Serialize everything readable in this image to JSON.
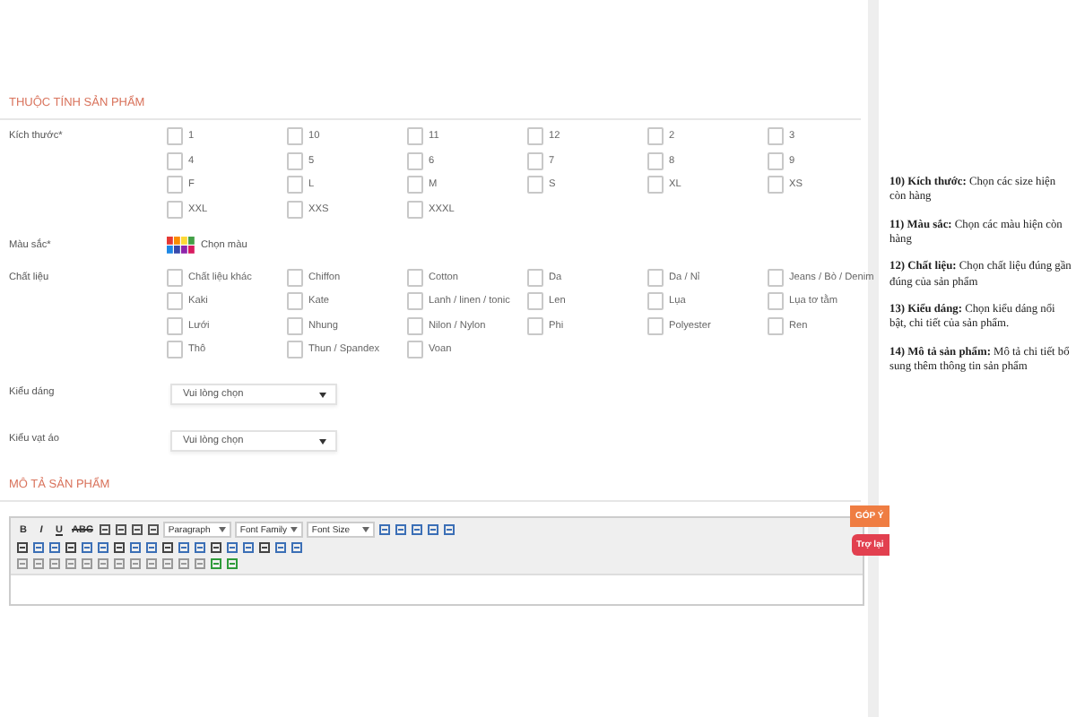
{
  "attributes_section": {
    "title": "THUỘC TÍNH SẢN PHẨM",
    "sizes": {
      "label": "Kích thước*",
      "options": [
        {
          "label": "1",
          "checked": false
        },
        {
          "label": "10",
          "checked": false
        },
        {
          "label": "11",
          "checked": false
        },
        {
          "label": "12",
          "checked": false
        },
        {
          "label": "2",
          "checked": false
        },
        {
          "label": "3",
          "checked": false
        },
        {
          "label": "4",
          "checked": false
        },
        {
          "label": "5",
          "checked": false
        },
        {
          "label": "6",
          "checked": false
        },
        {
          "label": "7",
          "checked": false
        },
        {
          "label": "8",
          "checked": false
        },
        {
          "label": "9",
          "checked": false
        },
        {
          "label": "F",
          "checked": false
        },
        {
          "label": "L",
          "checked": false
        },
        {
          "label": "M",
          "checked": false
        },
        {
          "label": "S",
          "checked": false
        },
        {
          "label": "XL",
          "checked": false
        },
        {
          "label": "XS",
          "checked": false
        },
        {
          "label": "XXL",
          "checked": false
        },
        {
          "label": "XXS",
          "checked": false
        },
        {
          "label": "XXXL",
          "checked": false
        }
      ]
    },
    "color": {
      "label": "Màu sắc*",
      "button": "Chọn màu"
    },
    "materials": {
      "label": "Chất liệu",
      "options": [
        {
          "label": "Chất liệu khác",
          "checked": false
        },
        {
          "label": "Chiffon",
          "checked": false
        },
        {
          "label": "Cotton",
          "checked": false
        },
        {
          "label": "Da",
          "checked": false
        },
        {
          "label": "Da / Nỉ",
          "checked": false
        },
        {
          "label": "Jeans / Bò / Denim",
          "checked": false
        },
        {
          "label": "Kaki",
          "checked": false
        },
        {
          "label": "Kate",
          "checked": false
        },
        {
          "label": "Lanh / linen / tonic",
          "checked": false
        },
        {
          "label": "Len",
          "checked": false
        },
        {
          "label": "Lụa",
          "checked": false
        },
        {
          "label": "Lụa tơ tằm",
          "checked": false
        },
        {
          "label": "Lưới",
          "checked": false
        },
        {
          "label": "Nhung",
          "checked": false
        },
        {
          "label": "Nilon / Nylon",
          "checked": false
        },
        {
          "label": "Phi",
          "checked": false
        },
        {
          "label": "Polyester",
          "checked": false
        },
        {
          "label": "Ren",
          "checked": false
        },
        {
          "label": "Thô",
          "checked": false
        },
        {
          "label": "Thun / Spandex",
          "checked": false
        },
        {
          "label": "Voan",
          "checked": false
        }
      ]
    },
    "selects": [
      {
        "label": "Kiểu dáng",
        "value": "Vui lòng chọn"
      },
      {
        "label": "Kiểu vạt áo",
        "value": "Vui lòng chọn"
      }
    ]
  },
  "description_section": {
    "title": "MÔ TẢ SẢN PHẨM",
    "format_buttons": [
      "B",
      "I",
      "U",
      "ABC"
    ],
    "dropdowns": [
      "Paragraph",
      "Font Family",
      "Font Size"
    ]
  },
  "side_tabs": [
    {
      "label": "GÓP Ý",
      "kind": "feedback"
    },
    {
      "label": "Trợ lại",
      "kind": "back"
    }
  ],
  "notes": [
    "**10) Kích thước:** Chọn các size hiện còn hàng",
    "**11) Màu sắc:** Chọn các màu hiện còn hàng",
    "**12) Chất liệu:** Chọn chất liệu đúng gần đúng của sản phẩm",
    "**13) Kiểu dáng:** Chọn kiểu dáng nổi bật, chi tiết của sản phẩm.",
    "**14) Mô tả sản phẩm:** Mô tả chi tiết bổ sung thêm thông tin sản phẩm"
  ]
}
